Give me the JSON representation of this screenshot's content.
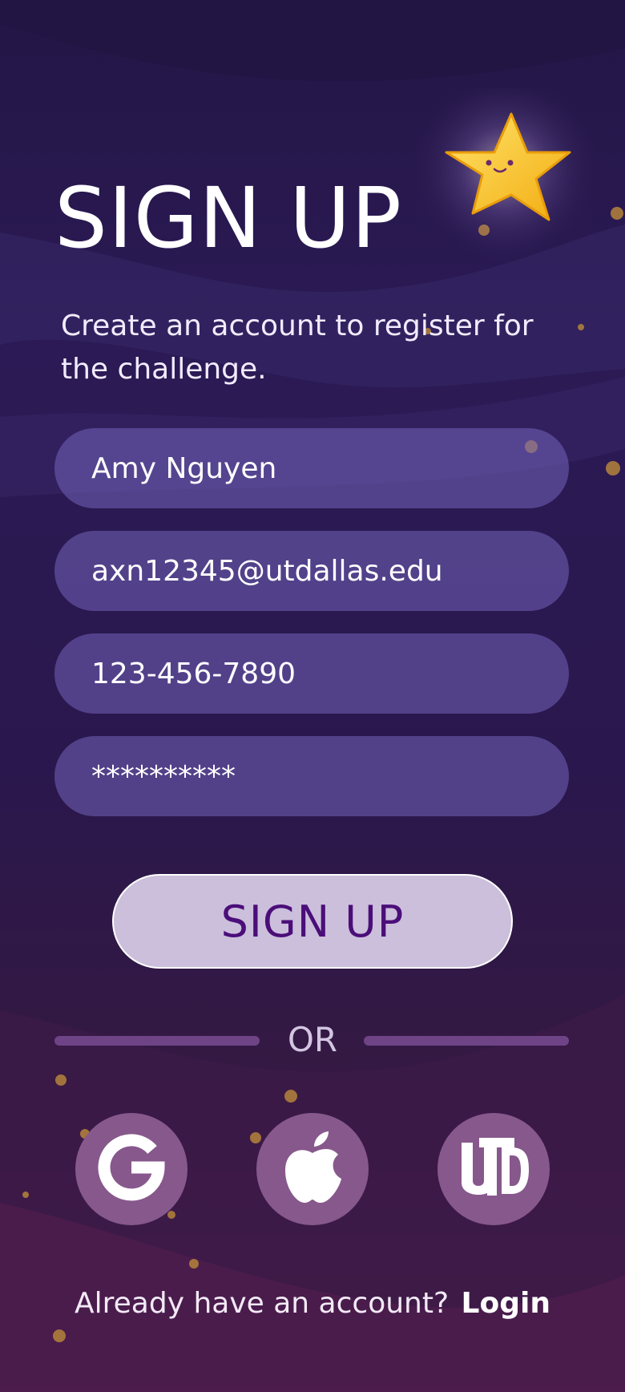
{
  "colors": {
    "background_top": "#241646",
    "background_bottom": "#4a1c4b",
    "field_fill": "#5c4d93",
    "primary_button": "#cbbfdc",
    "primary_text": "#4b0e79",
    "social_circle": "#87588c",
    "star": "#f7c51f"
  },
  "signup": {
    "title": "SIGN UP",
    "subtitle": "Create an account to register for the challenge."
  },
  "fields": {
    "name": {
      "value": "Amy Nguyen"
    },
    "email": {
      "value": "axn12345@utdallas.edu"
    },
    "phone": {
      "value": "123-456-7890"
    },
    "password": {
      "value": "**********"
    }
  },
  "actions": {
    "signup_label": "SIGN UP"
  },
  "divider": {
    "label": "OR"
  },
  "social": [
    {
      "name": "Google",
      "icon": "google-icon"
    },
    {
      "name": "Apple",
      "icon": "apple-icon"
    },
    {
      "name": "UTD",
      "icon": "utd-logo-icon"
    }
  ],
  "footer": {
    "prompt": "Already have an account?",
    "login_label": "Login"
  }
}
